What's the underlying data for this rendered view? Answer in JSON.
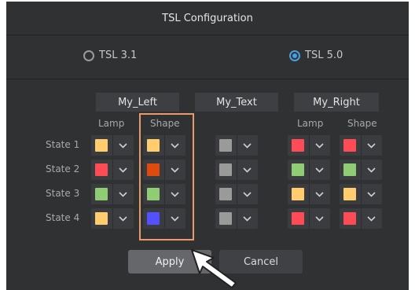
{
  "title": "TSL Configuration",
  "radios": [
    {
      "label": "TSL 3.1",
      "selected": false
    },
    {
      "label": "TSL 5.0",
      "selected": true
    }
  ],
  "groups": [
    "My_Left",
    "My_Text",
    "My_Right"
  ],
  "sublabels": {
    "left_lamp": "Lamp",
    "left_shape": "Shape",
    "right_lamp": "Lamp",
    "right_shape": "Shape"
  },
  "states": [
    "State 1",
    "State 2",
    "State 3",
    "State 4"
  ],
  "colors": {
    "left_lamp": [
      "#ffcc6e",
      "#ff4b55",
      "#8fcc73",
      "#ffcc6e"
    ],
    "left_shape": [
      "#ffcc6e",
      "#e04a0c",
      "#8fcc73",
      "#5550ff"
    ],
    "text": [
      "#9a9a9a",
      "#9a9a9a",
      "#9a9a9a",
      "#9a9a9a"
    ],
    "right_lamp": [
      "#ff4b55",
      "#8fcc73",
      "#ffcc6e",
      "#ff4b55"
    ],
    "right_shape": [
      "#ff4b55",
      "#8fcc73",
      "#ffcc6e",
      "#ff4b55"
    ]
  },
  "buttons": {
    "apply": "Apply",
    "cancel": "Cancel"
  },
  "accent": "#4a9fe0",
  "highlight_color": "#e89a6a"
}
